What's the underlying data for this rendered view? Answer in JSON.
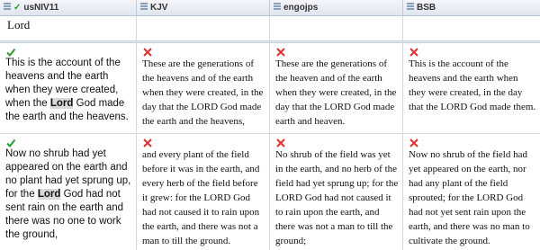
{
  "columns": [
    {
      "name": "usNIV11",
      "checked": true
    },
    {
      "name": "KJV"
    },
    {
      "name": "engojps"
    },
    {
      "name": "BSB"
    }
  ],
  "search": {
    "term": "Lord"
  },
  "icons": {
    "check": "checkmark-icon",
    "cross": "x-mark-icon",
    "column_menu": "grid-icon"
  },
  "colors": {
    "check": "#2e9b2e",
    "cross": "#e03030",
    "highlight": "#d9d9d9"
  },
  "rows": [
    {
      "cells": [
        {
          "mark": "check",
          "pre": "This is the account of the heavens and the earth when they were created, when the ",
          "hl": "Lord",
          "post": " God made the earth and the heavens."
        },
        {
          "mark": "cross",
          "text": "These are the generations of the heavens and of the earth when they were created, in the day that the LORD God made the earth and the heavens,"
        },
        {
          "mark": "cross",
          "text": "These are the generations of the heaven and of the earth when they were created, in the day that the LORD God made earth and heaven."
        },
        {
          "mark": "cross",
          "text": "This is the account of the heavens and the earth when they were created, in the day that the LORD God made them."
        }
      ]
    },
    {
      "cells": [
        {
          "mark": "check",
          "pre": "Now no shrub had yet appeared on the earth and no plant had yet sprung up, for the ",
          "hl": "Lord",
          "post": " God had not sent rain on the earth and there was no one to work the ground,"
        },
        {
          "mark": "cross",
          "text": "and every plant of the field before it was in the earth, and every herb of the field before it grew: for the LORD God had not caused it to rain upon the earth, and there was not a man to till the ground."
        },
        {
          "mark": "cross",
          "text": "No shrub of the field was yet in the earth, and no herb of the field had yet sprung up; for the LORD God had not caused it to rain upon the earth, and there was not a man to till the ground;"
        },
        {
          "mark": "cross",
          "text": "Now no shrub of the field had yet appeared on the earth, nor had any plant of the field sprouted; for the LORD God had not yet sent rain upon the earth, and there was no man to cultivate the ground."
        }
      ]
    }
  ]
}
